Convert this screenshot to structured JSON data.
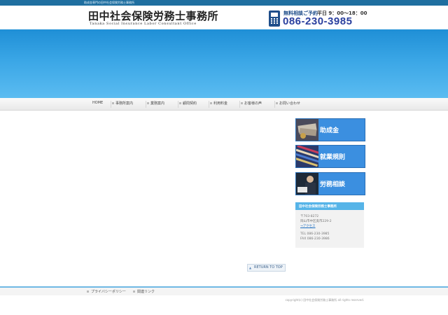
{
  "topbar": {
    "tagline": "助成金専門の田中社会保険労務士事務所"
  },
  "header": {
    "logo_jp": "田中社会保険労務士事務所",
    "logo_en": "Tanaka Social Insurance Labor Consultant Office",
    "call_label": "無料相談ご予約",
    "hours": "平日 9：00〜18：00",
    "phone": "086-230-3985"
  },
  "nav": {
    "items": [
      {
        "label": "HOME"
      },
      {
        "label": "事務所案内"
      },
      {
        "label": "業務案内"
      },
      {
        "label": "顧問契約"
      },
      {
        "label": "利用料金"
      },
      {
        "label": "お客様の声"
      },
      {
        "label": "お問い合わせ"
      }
    ]
  },
  "sidebar": {
    "buttons": [
      {
        "label": "助成金",
        "icon": "money-photo-icon"
      },
      {
        "label": "就業規則",
        "icon": "documents-photo-icon"
      },
      {
        "label": "労務相談",
        "icon": "consultation-photo-icon"
      }
    ],
    "office": {
      "title": "田中社会保険労務士事務所",
      "postal": "〒703-8272",
      "address": "岡山市中区奥市229-2",
      "access": "→アクセス",
      "tel": "TEL 086-230-3985",
      "fax": "FAX 086-230-3986"
    }
  },
  "main": {
    "return_top": "RETURN TO TOP"
  },
  "footer": {
    "links": [
      {
        "label": "プライバシーポリシー"
      },
      {
        "label": "関連リンク"
      }
    ],
    "copyright": "copyright(c) 田中社会保険労務士事務所 all rights reserved."
  },
  "colors": {
    "brand_blue": "#3b8fe0",
    "banner_top": "#1f8fd6",
    "banner_bottom": "#5bbcf1",
    "phone_blue": "#2a3f9e"
  }
}
